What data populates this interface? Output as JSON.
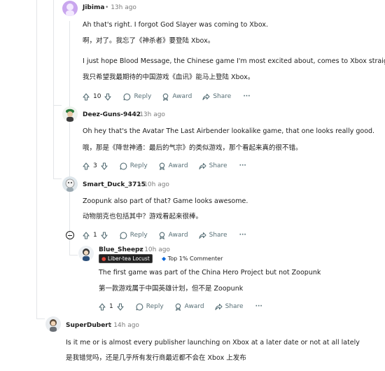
{
  "comments": [
    {
      "author": "Jibima",
      "time": "13h ago",
      "lines": [
        "Ah that's right. I forgot God Slayer was coming to Xbox.",
        "啊，对了。我忘了《神杀者》要登陆 Xbox。",
        "I just hope Blood Message, the Chinese game I'm most excited about, comes to Xbox straight a",
        "我只希望我最期待的中国游戏《血讯》能马上登陆 Xbox。"
      ],
      "votes": "10",
      "reply_label": "Reply",
      "award_label": "Award",
      "share_label": "Share",
      "avatar_color": "#c9a6ee"
    },
    {
      "author": "Deez-Guns-9442",
      "time": "13h ago",
      "lines": [
        "Oh hey that's the Avatar The Last Airbender lookalike game, that one looks really good.",
        "哦，那是《降世神通：最后的气宗》的类似游戏，那个看起来真的很不错。"
      ],
      "votes": "3",
      "reply_label": "Reply",
      "award_label": "Award",
      "share_label": "Share"
    },
    {
      "author": "Smart_Duck_3715",
      "time": "10h ago",
      "lines": [
        "Zoopunk also part of that? Game looks awesome.",
        "动物朋克也包括其中？游戏看起来很棒。"
      ],
      "votes": "1",
      "reply_label": "Reply",
      "award_label": "Award",
      "share_label": "Share"
    },
    {
      "author": "Blue_Sheepz",
      "time": "10h ago",
      "flair_primary": "Liber-tea Locust",
      "flair_secondary": "Top 1% Commenter",
      "lines": [
        "The first game was part of the China Hero Project but not Zoopunk",
        "第一款游戏属于中国英雄计划，但不是 Zoopunk"
      ],
      "votes": "1",
      "reply_label": "Reply",
      "award_label": "Award",
      "share_label": "Share"
    },
    {
      "author": "SuperDubert",
      "time": "14h ago",
      "lines": [
        "Is it me or is almost every publisher launching on Xbox at a later date or not at all lately",
        "是我错觉吗，还是几乎所有发行商最近都不会在 Xbox 上发布"
      ]
    }
  ],
  "separator": "•",
  "more_label": "···"
}
